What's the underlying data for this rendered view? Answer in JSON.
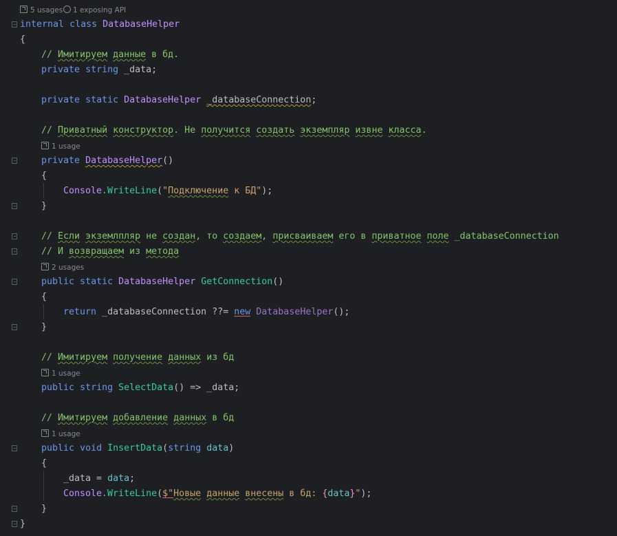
{
  "hints": {
    "class_usages": "5 usages",
    "exposing_api": "1 exposing API",
    "ctor_usages": "1 usage",
    "getconn_usages": "2 usages",
    "select_usages": "1 usage",
    "insert_usages": "1 usage"
  },
  "code": {
    "kw_internal": "internal",
    "kw_class": "class",
    "class_name": "DatabaseHelper",
    "brace_open": "{",
    "brace_close": "}",
    "comment_data": "// Имитируем данные в бд.",
    "kw_private": "private",
    "kw_string": "string",
    "field_data_decl": "_data;",
    "kw_static": "static",
    "type_dbhelper": "DatabaseHelper",
    "field_conn_decl": "_databaseConnection",
    "semicolon": ";",
    "comment_ctor": "// Приватный конструктор. Не получится создать экземпляр извне класса.",
    "ctor_name": "DatabaseHelper",
    "parens": "()",
    "console": "Console",
    "writeline": ".WriteLine",
    "str_connect": "\"Подключение к БД\"",
    "call_close": ");",
    "comment_if1": "// Если экземлпляр не создан, то создаем, присваиваем его в приватное поле _databaseConnection",
    "comment_if2": "// И возвращаем из метода",
    "kw_public": "public",
    "method_getconn": "GetConnection",
    "kw_return": "return",
    "field_conn": "_databaseConnection",
    "op_coalesce": "??=",
    "kw_new": "new",
    "new_tail": "();",
    "comment_select": "// Имитируем получение данных из бд",
    "method_select": "SelectData",
    "arrow_expr": "() => _data;",
    "comment_insert": "// Имитируем добавление данных в бд",
    "kw_void": "void",
    "method_insert": "InsertData",
    "param_data": "data",
    "field_data": "_data",
    "assign": " = ",
    "interp_prefix": "$\"",
    "interp_text": "Новые данные внесены в бд: ",
    "interp_open": "{",
    "interp_close": "}",
    "interp_end": "\"",
    "paren_open": "(",
    "paren_close": ")"
  },
  "colors": {
    "background": "#1e1f22",
    "keyword": "#6c95eb",
    "comment": "#85c46c",
    "string": "#c9a26d",
    "method": "#39cc9b",
    "class": "#c191ff"
  }
}
